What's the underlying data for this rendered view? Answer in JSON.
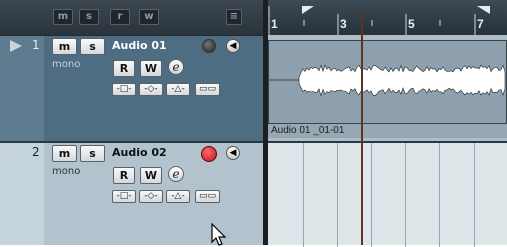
{
  "header": {
    "global_buttons": [
      "m",
      "s",
      "r",
      "w"
    ],
    "menu_glyph": "≡"
  },
  "ruler": {
    "bar_labels": [
      "1",
      "3",
      "5",
      "7"
    ]
  },
  "tracks": [
    {
      "number": "1",
      "name": "Audio 01",
      "mode": "mono",
      "mute": "m",
      "solo": "s",
      "read": "R",
      "write": "W",
      "edit": "e",
      "record_armed": false
    },
    {
      "number": "2",
      "name": "Audio 02",
      "mode": "mono",
      "mute": "m",
      "solo": "s",
      "read": "R",
      "write": "W",
      "edit": "e",
      "record_armed": true
    }
  ],
  "clip": {
    "name": "Audio 01 _01-01"
  },
  "icons": {
    "mouse_cursor": "arrow-cursor-icon",
    "speaker": "speaker-icon",
    "record": "record-icon"
  },
  "colors": {
    "record_active": "#d0202a",
    "track_selected_bg": "#4e6c82",
    "track_bg": "#b3c3cd",
    "playhead": "#c8926a"
  }
}
